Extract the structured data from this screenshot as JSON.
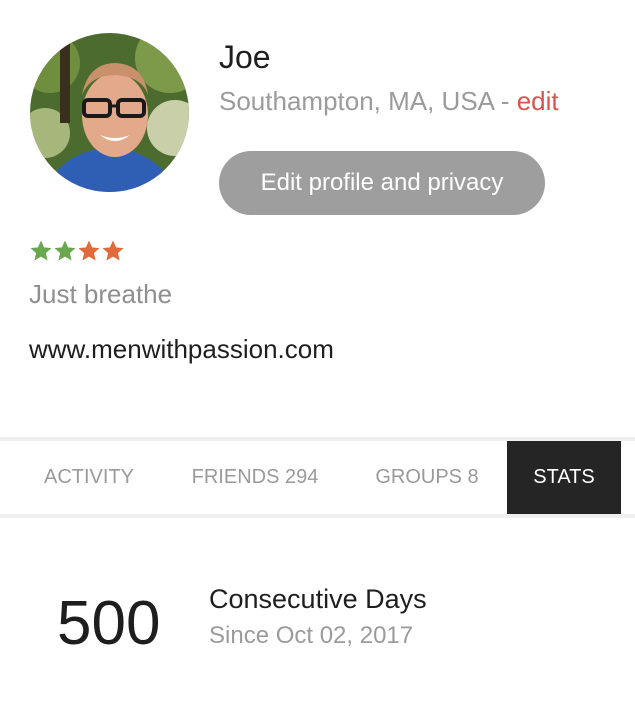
{
  "profile": {
    "name": "Joe",
    "location": "Southampton, MA, USA",
    "location_separator": " - ",
    "edit_link": "edit",
    "edit_profile_button": "Edit profile and privacy",
    "tagline": "Just breathe",
    "website": "www.menwithpassion.com",
    "rating": {
      "stars_total": 4,
      "stars": [
        "green",
        "green",
        "orange",
        "orange"
      ],
      "colors": {
        "green": "#6aa84f",
        "orange": "#e06a3b"
      }
    }
  },
  "tabs": [
    {
      "label": "ACTIVITY",
      "active": false
    },
    {
      "label": "FRIENDS 294",
      "active": false
    },
    {
      "label": "GROUPS 8",
      "active": false
    },
    {
      "label": "STATS",
      "active": true
    }
  ],
  "stats": {
    "value": "500",
    "title": "Consecutive Days",
    "subtitle": "Since Oct 02, 2017"
  },
  "colors": {
    "accent_red": "#d9534f",
    "button_gray": "#9e9e9e",
    "active_tab_bg": "#252525"
  },
  "icons": {
    "avatar": "profile-photo",
    "star": "star-icon"
  }
}
